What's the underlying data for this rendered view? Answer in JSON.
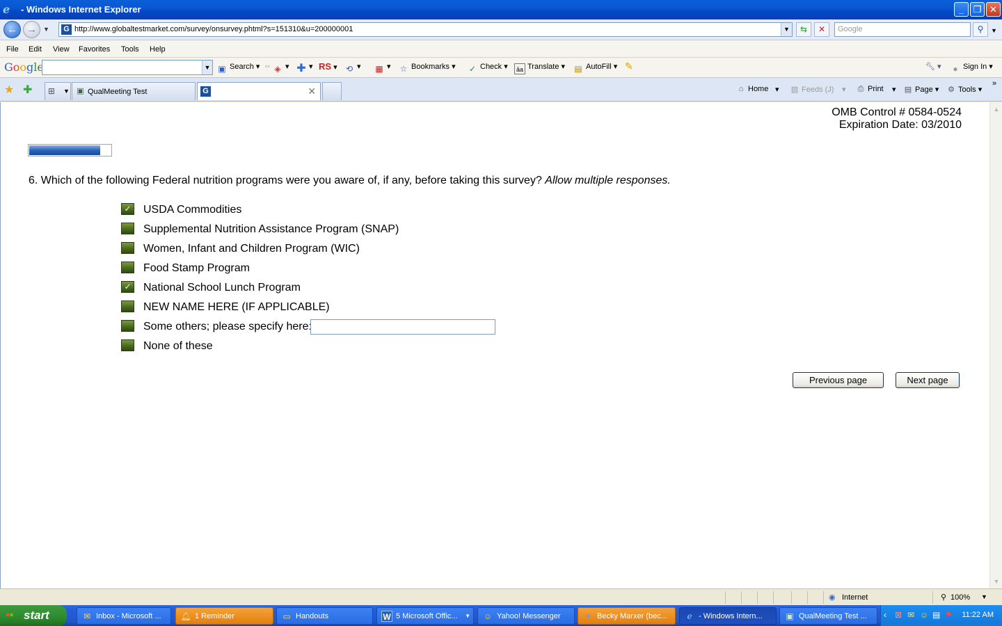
{
  "window": {
    "title": "- Windows Internet Explorer"
  },
  "address": {
    "url": "http://www.globaltestmarket.com/survey/onsurvey.phtml?s=151310&u=200000001",
    "search_placeholder": "Google"
  },
  "menu": [
    "File",
    "Edit",
    "View",
    "Favorites",
    "Tools",
    "Help"
  ],
  "google_toolbar": {
    "logo": "Google",
    "items": {
      "search": "Search",
      "bookmarks": "Bookmarks",
      "check": "Check",
      "translate": "Translate",
      "autofill": "AutoFill",
      "rs": "RS",
      "sign_in": "Sign In"
    }
  },
  "tabs": [
    {
      "label": "QualMeeting Test"
    },
    {
      "label": ""
    }
  ],
  "command_bar": {
    "home": "Home",
    "feeds": "Feeds (J)",
    "print": "Print",
    "page": "Page",
    "tools": "Tools"
  },
  "page": {
    "omb_line1": "OMB Control # 0584-0524",
    "omb_line2": "Expiration Date: 03/2010",
    "progress": 0.87,
    "question_text": "6. Which of the following Federal nutrition programs were you aware of, if any, before taking this survey?",
    "question_instruction": "Allow multiple responses.",
    "options": [
      {
        "label": "USDA Commodities",
        "checked": true
      },
      {
        "label": "Supplemental Nutrition Assistance Program (SNAP)",
        "checked": false
      },
      {
        "label": "Women, Infant and Children Program (WIC)",
        "checked": false
      },
      {
        "label": "Food Stamp Program",
        "checked": false
      },
      {
        "label": "National School Lunch Program",
        "checked": true
      },
      {
        "label": "NEW NAME HERE (IF APPLICABLE)",
        "checked": false
      },
      {
        "label": "Some others; please specify here:",
        "checked": false
      },
      {
        "label": "None of these",
        "checked": false
      }
    ],
    "other_value": "",
    "prev_label": "Previous page",
    "next_label": "Next page"
  },
  "status_bar": {
    "zone": "Internet",
    "zoom": "100%"
  },
  "taskbar": {
    "start": "start",
    "tasks": [
      {
        "label": "Inbox - Microsoft ..."
      },
      {
        "label": "1 Reminder"
      },
      {
        "label": "Handouts"
      },
      {
        "label": "5 Microsoft Offic..."
      },
      {
        "label": "Yahoo! Messenger"
      },
      {
        "label": "Becky Marxer (bec..."
      },
      {
        "label": "- Windows Intern..."
      },
      {
        "label": "QualMeeting Test ..."
      }
    ],
    "clock": "11:22 AM"
  }
}
